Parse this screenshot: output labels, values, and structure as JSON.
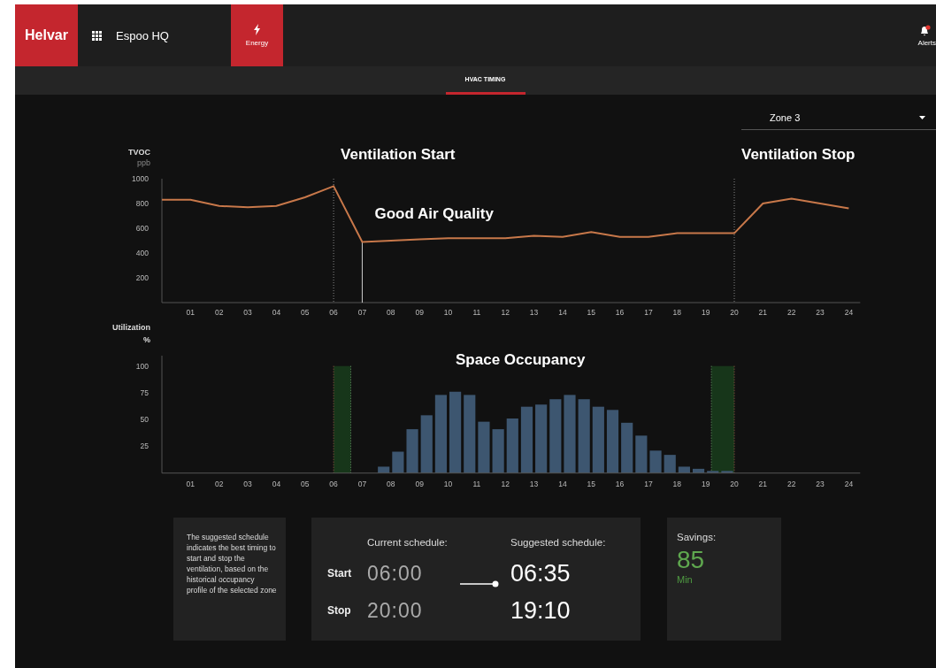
{
  "top_bar": {
    "logo": "Helvar",
    "site": "Espoo HQ",
    "nav": [
      {
        "label": "Energy",
        "selected": true
      }
    ],
    "alerts": {
      "label": "Alerts",
      "unread": true
    }
  },
  "tabs": [
    {
      "label": "HVAC TIMING",
      "selected": true
    }
  ],
  "zone_select": {
    "value": "Zone 3"
  },
  "tvoc_chart": {
    "y_unit": "ppb",
    "labels": [
      "Ventilation Start",
      "Good Air Quality",
      "Ventilation Stop"
    ],
    "chart_data": {
      "type": "line",
      "x": [
        0,
        1,
        2,
        3,
        4,
        5,
        6,
        7,
        8,
        9,
        10,
        11,
        12,
        13,
        14,
        15,
        16,
        17,
        18,
        19,
        20,
        21,
        22,
        23,
        24
      ],
      "series": [
        {
          "name": "TVOC",
          "color": "#c8784a",
          "values": [
            830,
            830,
            780,
            770,
            780,
            850,
            940,
            490,
            500,
            510,
            520,
            520,
            520,
            540,
            530,
            570,
            530,
            530,
            560,
            560,
            560,
            800,
            840,
            800,
            760
          ]
        }
      ],
      "xlim": [
        0,
        24.4
      ],
      "ylim": [
        0,
        1000
      ],
      "yticks": [
        200,
        400,
        600,
        800,
        1000
      ],
      "xticks": [
        {
          "value": 1,
          "label": "01"
        },
        {
          "value": 2,
          "label": "02"
        },
        {
          "value": 3,
          "label": "03"
        },
        {
          "value": 4,
          "label": "04"
        },
        {
          "value": 5,
          "label": "05"
        },
        {
          "value": 6,
          "label": "06"
        },
        {
          "value": 7,
          "label": "07"
        },
        {
          "value": 8,
          "label": "08"
        },
        {
          "value": 9,
          "label": "09"
        },
        {
          "value": 10,
          "label": "10"
        },
        {
          "value": 11,
          "label": "11"
        },
        {
          "value": 12,
          "label": "12"
        },
        {
          "value": 13,
          "label": "13"
        },
        {
          "value": 14,
          "label": "14"
        },
        {
          "value": 15,
          "label": "15"
        },
        {
          "value": 16,
          "label": "16"
        },
        {
          "value": 17,
          "label": "17"
        },
        {
          "value": 18,
          "label": "18"
        },
        {
          "value": 19,
          "label": "19"
        },
        {
          "value": 20,
          "label": "20"
        },
        {
          "value": 21,
          "label": "21"
        },
        {
          "value": 22,
          "label": "22"
        },
        {
          "value": 23,
          "label": "23"
        },
        {
          "value": 24,
          "label": "24"
        }
      ],
      "ref_lines": [
        {
          "axis": "x",
          "value": 6
        },
        {
          "axis": "x",
          "value": 7
        },
        {
          "axis": "x",
          "value": 20
        }
      ]
    }
  },
  "occupancy_chart": {
    "y_title": "Utilization",
    "y_unit": "%",
    "chart_data": {
      "type": "bar",
      "title": "Space Occupancy",
      "x": [
        7.75,
        8.25,
        8.75,
        9.25,
        9.75,
        10.25,
        10.75,
        11.25,
        11.75,
        12.25,
        12.75,
        13.25,
        13.75,
        14.25,
        14.75,
        15.25,
        15.75,
        16.25,
        16.75,
        17.25,
        17.75,
        18.25,
        18.75,
        19.25,
        19.75
      ],
      "values": [
        6,
        20,
        41,
        54,
        73,
        76,
        73,
        48,
        41,
        51,
        62,
        64,
        69,
        73,
        69,
        62,
        59,
        47,
        35,
        21,
        17,
        6,
        4,
        2,
        2
      ],
      "xlim": [
        0,
        24.4
      ],
      "ylim": [
        0,
        100
      ],
      "yticks": [
        25,
        50,
        75,
        100
      ],
      "xticks": [
        {
          "value": 1,
          "label": "01"
        },
        {
          "value": 2,
          "label": "02"
        },
        {
          "value": 3,
          "label": "03"
        },
        {
          "value": 4,
          "label": "04"
        },
        {
          "value": 5,
          "label": "05"
        },
        {
          "value": 6,
          "label": "06"
        },
        {
          "value": 7,
          "label": "07"
        },
        {
          "value": 8,
          "label": "08"
        },
        {
          "value": 9,
          "label": "09"
        },
        {
          "value": 10,
          "label": "10"
        },
        {
          "value": 11,
          "label": "11"
        },
        {
          "value": 12,
          "label": "12"
        },
        {
          "value": 13,
          "label": "13"
        },
        {
          "value": 14,
          "label": "14"
        },
        {
          "value": 15,
          "label": "15"
        },
        {
          "value": 16,
          "label": "16"
        },
        {
          "value": 17,
          "label": "17"
        },
        {
          "value": 18,
          "label": "18"
        },
        {
          "value": 19,
          "label": "19"
        },
        {
          "value": 20,
          "label": "20"
        },
        {
          "value": 21,
          "label": "21"
        },
        {
          "value": 22,
          "label": "22"
        },
        {
          "value": 23,
          "label": "23"
        },
        {
          "value": 24,
          "label": "24"
        }
      ],
      "bands": [
        {
          "axis": "x",
          "from": 6,
          "to": 6.6
        },
        {
          "axis": "x",
          "from": 19.2,
          "to": 20
        }
      ],
      "ref_lines": [
        {
          "axis": "x",
          "value": 6,
          "color": "#a05a4a"
        },
        {
          "axis": "x",
          "value": 6.6,
          "color": "#6a9a6a"
        },
        {
          "axis": "x",
          "value": 19.2,
          "color": "#6a9a6a"
        },
        {
          "axis": "x",
          "value": 20,
          "color": "#a05a4a"
        }
      ]
    }
  },
  "info": "The suggested schedule indicates the best timing to start and stop the ventilation, based on the historical occupancy profile of the selected zone",
  "schedule": {
    "current_header": "Current schedule:",
    "suggested_header": "Suggested schedule:",
    "rows": [
      {
        "label": "Start",
        "current": "06:00",
        "suggested": "06:35"
      },
      {
        "label": "Stop",
        "current": "20:00",
        "suggested": "19:10"
      }
    ]
  },
  "savings": {
    "label": "Savings:",
    "value": "85",
    "unit": "Min"
  }
}
